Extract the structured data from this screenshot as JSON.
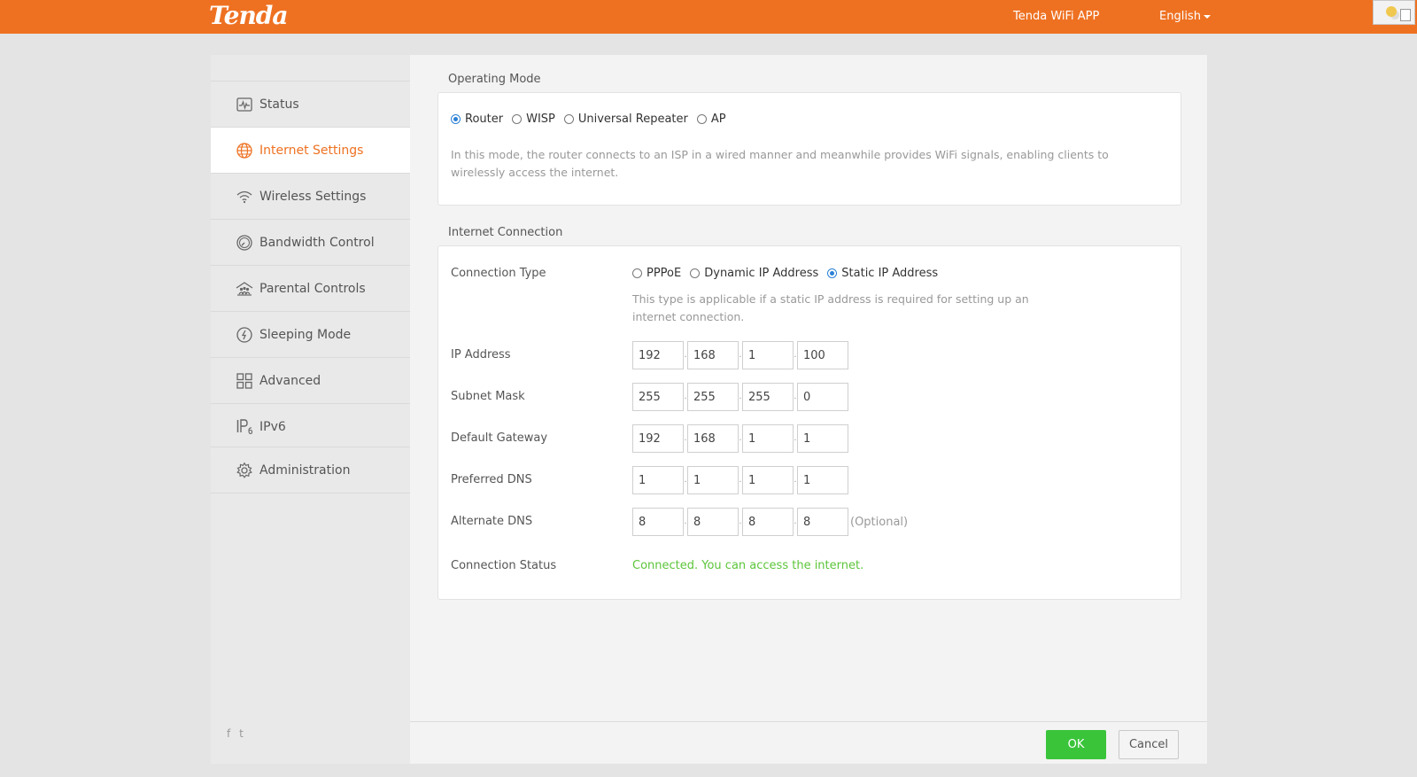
{
  "header": {
    "logo": "Tenda",
    "app_link": "Tenda WiFi APP",
    "language": "English"
  },
  "sidebar": {
    "items": [
      {
        "label": "Status",
        "icon": "status-icon"
      },
      {
        "label": "Internet Settings",
        "icon": "globe-icon",
        "active": true
      },
      {
        "label": "Wireless Settings",
        "icon": "wifi-icon"
      },
      {
        "label": "Bandwidth Control",
        "icon": "gauge-icon"
      },
      {
        "label": "Parental Controls",
        "icon": "family-icon"
      },
      {
        "label": "Sleeping Mode",
        "icon": "power-icon"
      },
      {
        "label": "Advanced",
        "icon": "grid-icon"
      },
      {
        "label": "IPv6",
        "icon": "ipv6-icon"
      },
      {
        "label": "Administration",
        "icon": "gear-icon"
      }
    ],
    "social": [
      "f",
      "t"
    ]
  },
  "operating_mode": {
    "title": "Operating Mode",
    "options": [
      "Router",
      "WISP",
      "Universal Repeater",
      "AP"
    ],
    "selected": "Router",
    "description": "In this mode, the router connects to an ISP in a wired manner and meanwhile provides WiFi signals, enabling clients to wirelessly access the internet."
  },
  "internet_connection": {
    "title": "Internet Connection",
    "connection_type": {
      "label": "Connection Type",
      "options": [
        "PPPoE",
        "Dynamic IP Address",
        "Static IP Address"
      ],
      "selected": "Static IP Address",
      "description": "This type is applicable if a static IP address is required for setting up an internet connection."
    },
    "fields": [
      {
        "label": "IP Address",
        "values": [
          "192",
          "168",
          "1",
          "100"
        ]
      },
      {
        "label": "Subnet Mask",
        "values": [
          "255",
          "255",
          "255",
          "0"
        ]
      },
      {
        "label": "Default Gateway",
        "values": [
          "192",
          "168",
          "1",
          "1"
        ]
      },
      {
        "label": "Preferred DNS",
        "values": [
          "1",
          "1",
          "1",
          "1"
        ]
      },
      {
        "label": "Alternate DNS",
        "values": [
          "8",
          "8",
          "8",
          "8"
        ],
        "suffix": "(Optional)"
      }
    ],
    "status": {
      "label": "Connection Status",
      "value": "Connected. You can access the internet."
    }
  },
  "buttons": {
    "ok": "OK",
    "cancel": "Cancel"
  },
  "colors": {
    "brand": "#ee7122",
    "ok": "#3ac43a",
    "status_ok": "#5cc53a",
    "radio": "#2b80d6"
  }
}
